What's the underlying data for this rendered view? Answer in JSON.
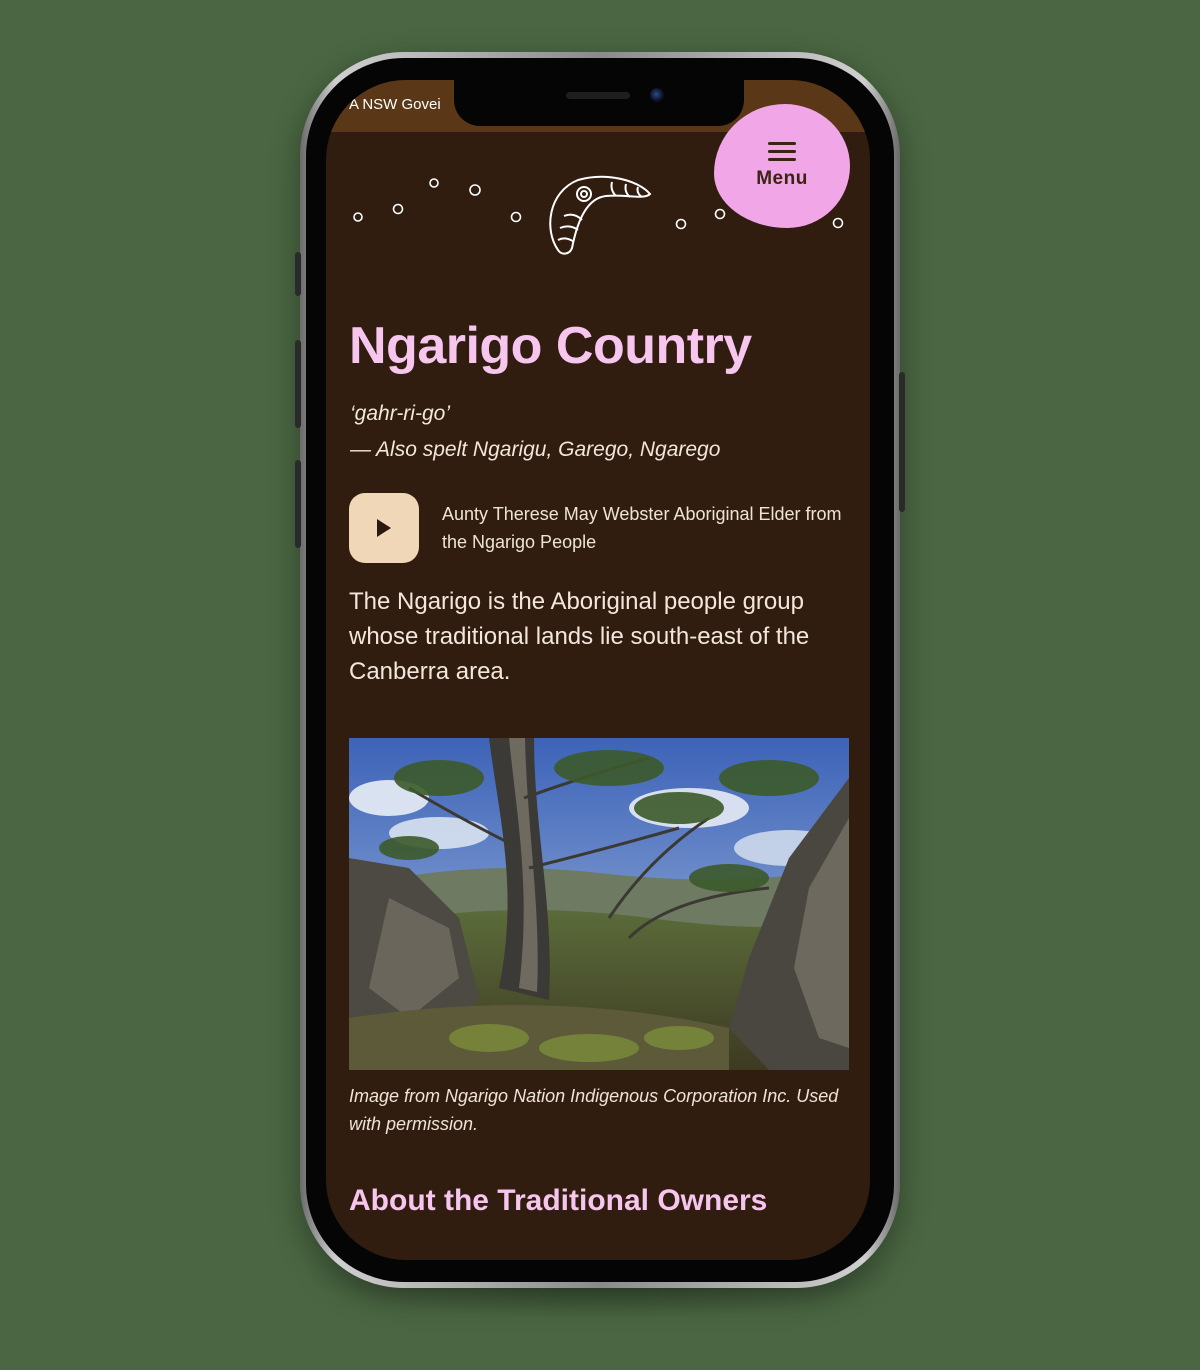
{
  "gov_banner": "A NSW Govei",
  "menu_label": "Menu",
  "title": "Ngarigo Country",
  "pronunciation": "‘gahr-ri-go’",
  "alt_spellings": "— Also spelt Ngarigu, Garego, Ngarego",
  "audio_caption": "Aunty Therese May Webster Aboriginal Elder from the Ngarigo People",
  "intro": "The Ngarigo is the Aboriginal people group whose traditional lands lie south-east of the Canberra area.",
  "image_caption": "Image from Ngarigo Nation Indigenous Corporation Inc. Used with permission.",
  "section_heading": "About the Traditional Owners",
  "colors": {
    "background": "#4a6642",
    "screen": "#301d0f",
    "gov_bar": "#5a3717",
    "accent_pink": "#f6c6ee",
    "menu_blob": "#f1a6e8",
    "play_button": "#f0d7b7"
  },
  "icons": [
    "hamburger-icon",
    "boomerang-icon",
    "play-icon"
  ]
}
